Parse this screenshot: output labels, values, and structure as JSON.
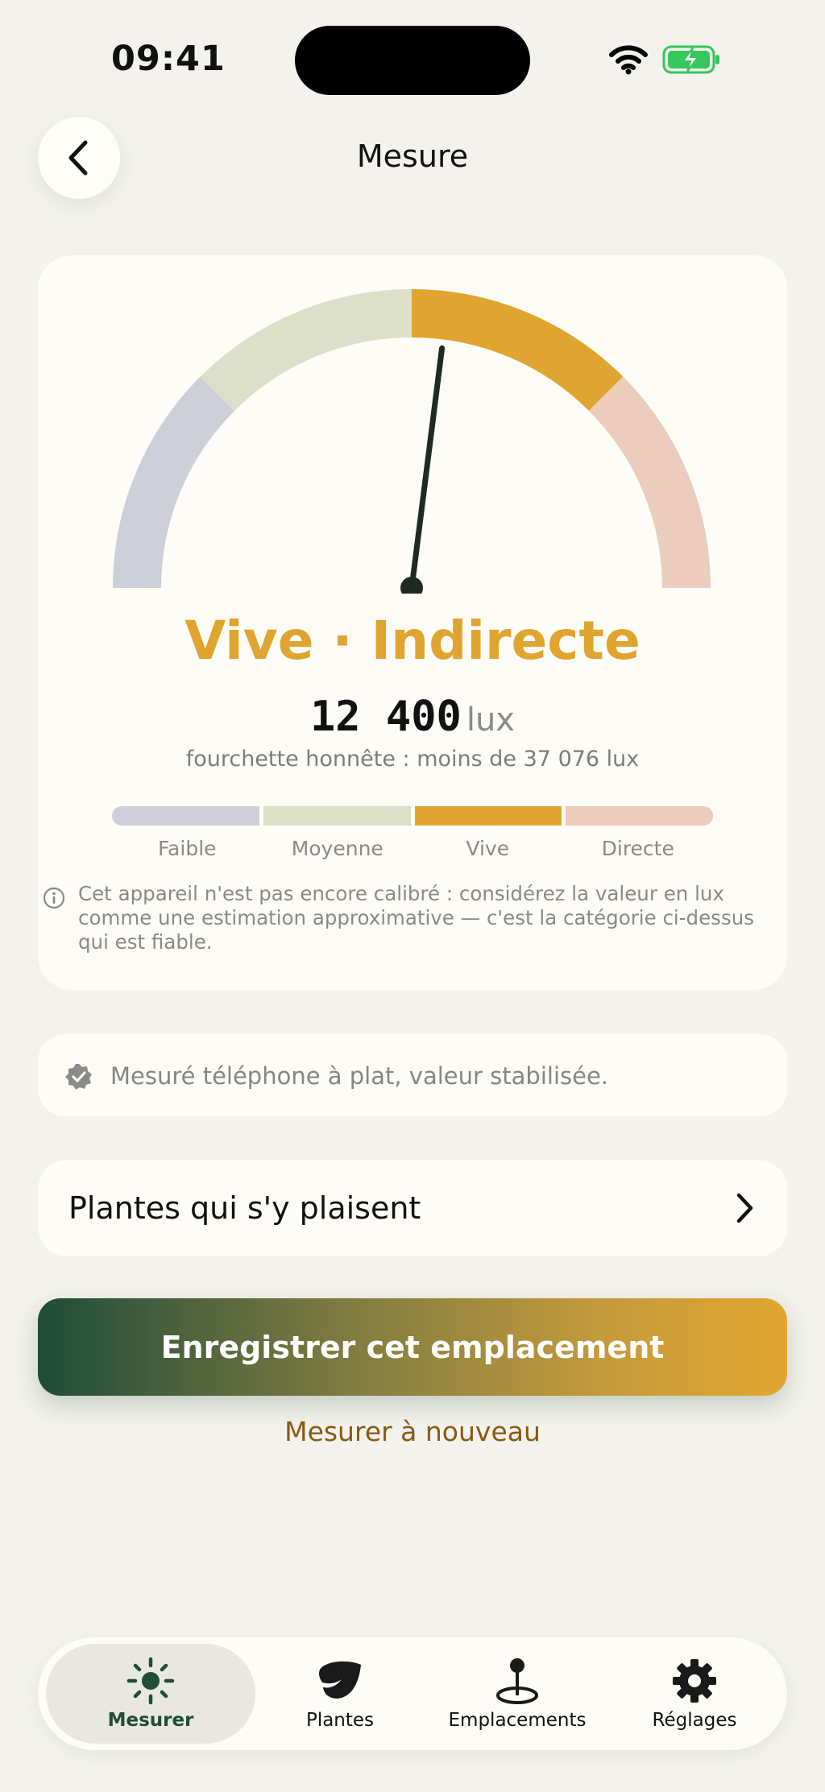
{
  "status_bar": {
    "time": "09:41"
  },
  "header": {
    "title": "Mesure"
  },
  "reading": {
    "category": "Vive · Indirecte",
    "lux_value": "12 400",
    "lux_unit": "lux",
    "range_note": "fourchette honnête : moins de 37 076 lux",
    "needle_fraction": 0.54
  },
  "scale": {
    "levels": [
      {
        "label": "Faible",
        "color": "#cdd0d8"
      },
      {
        "label": "Moyenne",
        "color": "#dde0c8"
      },
      {
        "label": "Vive",
        "color": "#e0a530"
      },
      {
        "label": "Directe",
        "color": "#ecccba"
      }
    ]
  },
  "calibration_note": "Cet appareil n'est pas encore calibré : considérez la valeur en lux comme une estimation approximative — c'est la catégorie ci-dessus qui est fiable.",
  "measurement_status": "Mesuré téléphone à plat, valeur stabilisée.",
  "plants_link": "Plantes qui s'y plaisent",
  "actions": {
    "save": "Enregistrer cet emplacement",
    "remeasure": "Mesurer à nouveau"
  },
  "tabs": [
    {
      "label": "Mesurer",
      "icon": "sun-icon",
      "active": true
    },
    {
      "label": "Plantes",
      "icon": "leaf-icon",
      "active": false
    },
    {
      "label": "Emplacements",
      "icon": "location-pin-icon",
      "active": false
    },
    {
      "label": "Réglages",
      "icon": "gear-icon",
      "active": false
    }
  ],
  "colors": {
    "accent": "#e0a530",
    "brand_green": "#1e4d38",
    "link_brown": "#8a5a10"
  }
}
